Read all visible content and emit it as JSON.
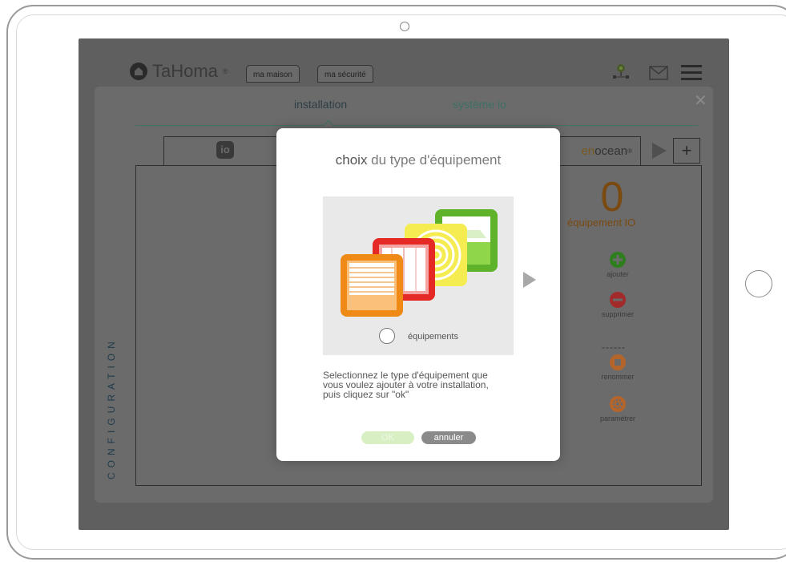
{
  "header": {
    "logo_text": "TaHoma",
    "logo_mark": "®",
    "tabs": [
      {
        "label": "ma maison"
      },
      {
        "label": "ma sécurité"
      }
    ],
    "icons": [
      "network-icon",
      "mail-icon",
      "menu-icon"
    ]
  },
  "config": {
    "tabs": [
      {
        "label": "installation",
        "active": true
      },
      {
        "label": "système io",
        "active": false
      }
    ],
    "protocols": [
      {
        "label": "io",
        "mark": "®"
      },
      {
        "label_prefix": "en",
        "label": "ocean",
        "mark": "®"
      }
    ],
    "count": "0",
    "count_label": "équipement  IO",
    "actions": [
      {
        "label": "ajouter",
        "icon": "plus-icon",
        "color": "#2e7d1f"
      },
      {
        "label": "supprimer",
        "icon": "minus-icon",
        "color": "#a32a2a"
      },
      {
        "label": "renommer",
        "icon": "rename-icon",
        "color": "#b5652a"
      },
      {
        "label": "paramétrer",
        "icon": "settings-icon",
        "color": "#b5652a"
      }
    ],
    "separator": "------",
    "side_label": "CONFIGURATION",
    "close_symbol": "✕"
  },
  "modal": {
    "title_lead": "choix",
    "title_rest": " du type d'équipement",
    "radio_label": "équipements",
    "description": "Selectionnez le type d'équipement que\nvous voulez ajouter à votre installation,\npuis cliquez sur \"ok\"",
    "ok_label": "OK",
    "cancel_label": "annuler"
  },
  "colors": {
    "accent_green": "#7fc241",
    "accent_orange": "#f08a17",
    "accent_red": "#e52a26",
    "accent_yellow": "#f2e23a"
  }
}
